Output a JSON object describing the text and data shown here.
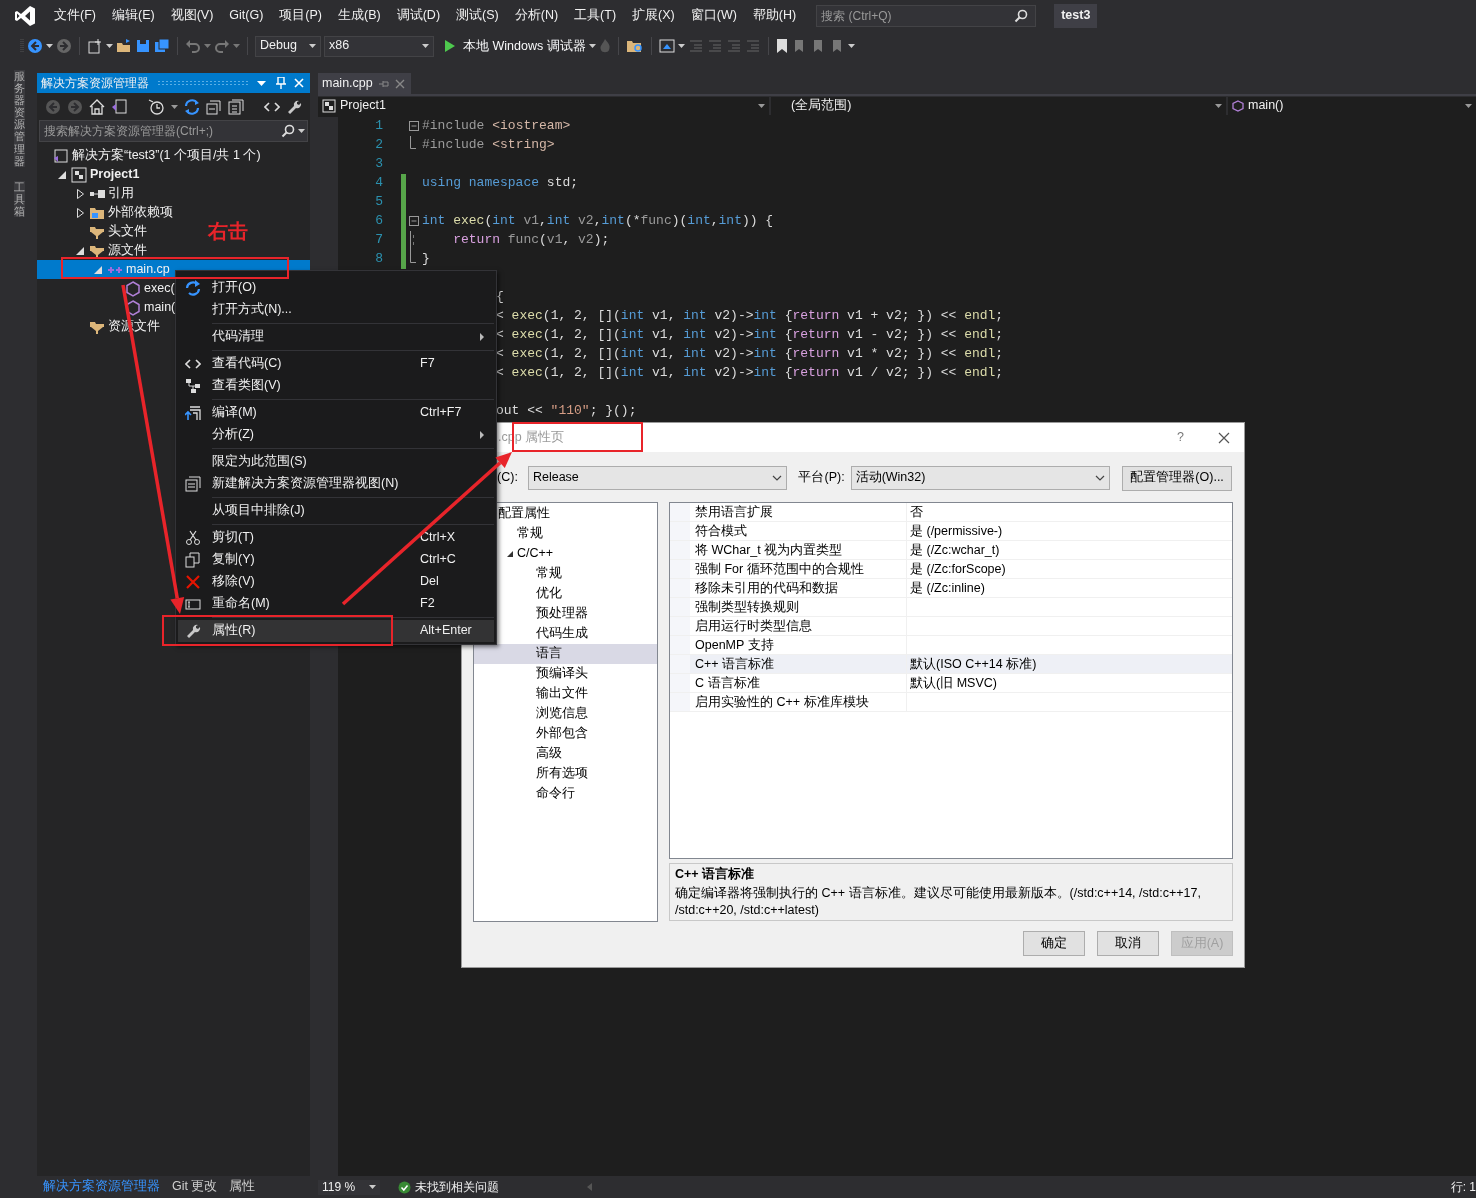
{
  "menu_bar": {
    "items": [
      "文件(F)",
      "编辑(E)",
      "视图(V)",
      "Git(G)",
      "项目(P)",
      "生成(B)",
      "调试(D)",
      "测试(S)",
      "分析(N)",
      "工具(T)",
      "扩展(X)",
      "窗口(W)",
      "帮助(H)"
    ]
  },
  "search": {
    "placeholder": "搜索 (Ctrl+Q)"
  },
  "solution_name": "test3",
  "toolbar": {
    "configuration": "Debug",
    "platform": "x86",
    "run_button": "本地 Windows 调试器"
  },
  "side_tabs": [
    "服务器资源管理器",
    "工具箱"
  ],
  "solution_explorer": {
    "title": "解决方案资源管理器",
    "search": {
      "placeholder": "搜索解决方案资源管理器(Ctrl+;)"
    },
    "tree": [
      {
        "label": "解决方案“test3”(1 个项目/共 1 个)",
        "kind": "solution",
        "selected": false,
        "children": [
          {
            "label": "Project1",
            "kind": "project",
            "expanded": true,
            "selected": false,
            "children": [
              {
                "label": "引用",
                "kind": "references",
                "expanded": false,
                "selected": false
              },
              {
                "label": "外部依赖项",
                "kind": "dependencies",
                "expanded": false,
                "selected": false
              },
              {
                "label": "头文件",
                "kind": "folder",
                "selected": false
              },
              {
                "label": "源文件",
                "kind": "folder",
                "expanded": true,
                "selected": false,
                "children": [
                  {
                    "label": "main.cp",
                    "kind": "cpp",
                    "expanded": true,
                    "selected": true,
                    "children": [
                      {
                        "label": "exec(",
                        "kind": "function",
                        "selected": false
                      },
                      {
                        "label": "main(",
                        "kind": "function",
                        "selected": false
                      }
                    ]
                  }
                ]
              },
              {
                "label": "资源文件",
                "kind": "folder",
                "selected": false
              }
            ]
          }
        ]
      }
    ]
  },
  "bottom_tabs": [
    {
      "label": "解决方案资源管理器",
      "selected": true
    },
    {
      "label": "Git 更改",
      "selected": false
    },
    {
      "label": "属性",
      "selected": false
    }
  ],
  "editor": {
    "tabs": [
      {
        "label": "main.cpp",
        "selected": true
      }
    ],
    "nav": {
      "project": "Project1",
      "scope": "(全局范围)",
      "member": "main()"
    },
    "lines": [
      {
        "number": "1",
        "kind": "opener",
        "modified": false,
        "tokens": [
          {
            "kind": "pre",
            "text": "#include"
          },
          {
            "kind": "inc",
            "text": " <iostream>"
          }
        ]
      },
      {
        "number": "2",
        "kind": "closer",
        "modified": false,
        "tokens": [
          {
            "kind": "pre",
            "text": "#include"
          },
          {
            "kind": "inc",
            "text": " <string>"
          }
        ]
      },
      {
        "number": "3",
        "kind": "plain",
        "modified": false
      },
      {
        "number": "4",
        "kind": "plain",
        "modified": true,
        "tokens": [
          {
            "kind": "kw",
            "text": "using"
          },
          {
            "kind": "kw",
            "text": " namespace"
          },
          {
            "kind": "plain",
            "text": " std;"
          }
        ]
      },
      {
        "number": "5",
        "kind": "plain",
        "modified": true
      },
      {
        "number": "6",
        "kind": "opener",
        "modified": true,
        "tokens": [
          {
            "kind": "kw",
            "text": "int"
          },
          {
            "kind": "fn",
            "text": " exec"
          },
          {
            "kind": "plain",
            "text": "("
          },
          {
            "kind": "kw",
            "text": "int"
          },
          {
            "kind": "param",
            "text": " v1"
          },
          {
            "kind": "plain",
            "text": ","
          },
          {
            "kind": "kw",
            "text": "int"
          },
          {
            "kind": "param",
            "text": " v2"
          },
          {
            "kind": "plain",
            "text": ","
          },
          {
            "kind": "kw",
            "text": "int"
          },
          {
            "kind": "plain",
            "text": "(*"
          },
          {
            "kind": "param",
            "text": "func"
          },
          {
            "kind": "plain",
            "text": ")("
          },
          {
            "kind": "kw",
            "text": "int"
          },
          {
            "kind": "plain",
            "text": ","
          },
          {
            "kind": "kw",
            "text": "int"
          },
          {
            "kind": "plain",
            "text": ")) {"
          }
        ]
      },
      {
        "number": "7",
        "kind": "inner",
        "modified": true,
        "tokens": [
          {
            "kind": "ctl",
            "text": "    return"
          },
          {
            "kind": "param",
            "text": " func"
          },
          {
            "kind": "plain",
            "text": "("
          },
          {
            "kind": "param",
            "text": "v1"
          },
          {
            "kind": "plain",
            "text": ", "
          },
          {
            "kind": "param",
            "text": "v2"
          },
          {
            "kind": "plain",
            "text": ");"
          }
        ]
      },
      {
        "number": "8",
        "kind": "closer",
        "modified": true,
        "tokens": [
          {
            "kind": "plain",
            "text": "}"
          }
        ]
      },
      {
        "kind": "partial"
      },
      {
        "kind": "partial",
        "tokens": [
          {
            "kind": "plain",
            "text": "{"
          }
        ]
      },
      {
        "kind": "partial",
        "tokens": [
          {
            "kind": "plain",
            "text": "<"
          },
          {
            "kind": "fn",
            "text": " exec"
          },
          {
            "kind": "plain",
            "text": "(1, 2, []("
          },
          {
            "kind": "kw",
            "text": "int"
          },
          {
            "kind": "plain",
            "text": " v1, "
          },
          {
            "kind": "kw",
            "text": "int"
          },
          {
            "kind": "plain",
            "text": " v2)->"
          },
          {
            "kind": "kw",
            "text": "int"
          },
          {
            "kind": "plain",
            "text": " {"
          },
          {
            "kind": "ctl",
            "text": "return"
          },
          {
            "kind": "plain",
            "text": " v1 + v2; }) << "
          },
          {
            "kind": "fn",
            "text": "endl"
          },
          {
            "kind": "plain",
            "text": ";"
          }
        ]
      },
      {
        "kind": "partial",
        "tokens": [
          {
            "kind": "plain",
            "text": "<"
          },
          {
            "kind": "fn",
            "text": " exec"
          },
          {
            "kind": "plain",
            "text": "(1, 2, []("
          },
          {
            "kind": "kw",
            "text": "int"
          },
          {
            "kind": "plain",
            "text": " v1, "
          },
          {
            "kind": "kw",
            "text": "int"
          },
          {
            "kind": "plain",
            "text": " v2)->"
          },
          {
            "kind": "kw",
            "text": "int"
          },
          {
            "kind": "plain",
            "text": " {"
          },
          {
            "kind": "ctl",
            "text": "return"
          },
          {
            "kind": "plain",
            "text": " v1 - v2; }) << "
          },
          {
            "kind": "fn",
            "text": "endl"
          },
          {
            "kind": "plain",
            "text": ";"
          }
        ]
      },
      {
        "kind": "partial",
        "tokens": [
          {
            "kind": "plain",
            "text": "<"
          },
          {
            "kind": "fn",
            "text": " exec"
          },
          {
            "kind": "plain",
            "text": "(1, 2, []("
          },
          {
            "kind": "kw",
            "text": "int"
          },
          {
            "kind": "plain",
            "text": " v1, "
          },
          {
            "kind": "kw",
            "text": "int"
          },
          {
            "kind": "plain",
            "text": " v2)->"
          },
          {
            "kind": "kw",
            "text": "int"
          },
          {
            "kind": "plain",
            "text": " {"
          },
          {
            "kind": "ctl",
            "text": "return"
          },
          {
            "kind": "plain",
            "text": " v1 * v2; }) << "
          },
          {
            "kind": "fn",
            "text": "endl"
          },
          {
            "kind": "plain",
            "text": ";"
          }
        ]
      },
      {
        "kind": "partial",
        "tokens": [
          {
            "kind": "plain",
            "text": "<"
          },
          {
            "kind": "fn",
            "text": " exec"
          },
          {
            "kind": "plain",
            "text": "(1, 2, []("
          },
          {
            "kind": "kw",
            "text": "int"
          },
          {
            "kind": "plain",
            "text": " v1, "
          },
          {
            "kind": "kw",
            "text": "int"
          },
          {
            "kind": "plain",
            "text": " v2)->"
          },
          {
            "kind": "kw",
            "text": "int"
          },
          {
            "kind": "plain",
            "text": " {"
          },
          {
            "kind": "ctl",
            "text": "return"
          },
          {
            "kind": "plain",
            "text": " v1 / v2; }) << "
          },
          {
            "kind": "fn",
            "text": "endl"
          },
          {
            "kind": "plain",
            "text": ";"
          }
        ]
      },
      {
        "kind": "partial"
      },
      {
        "kind": "partial",
        "tokens": [
          {
            "kind": "plain",
            "text": "out << "
          },
          {
            "kind": "str",
            "text": "\"110\""
          },
          {
            "kind": "plain",
            "text": "; }();"
          }
        ]
      }
    ]
  },
  "status_bar": {
    "zoom": "119 %",
    "issues": "未找到相关问题",
    "position": "行: 1"
  },
  "context_menu": {
    "items": [
      {
        "kind": "item",
        "label": "打开(O)",
        "selected": false,
        "submenu": false
      },
      {
        "kind": "item",
        "label": "打开方式(N)...",
        "selected": false,
        "submenu": false
      },
      {
        "kind": "separator"
      },
      {
        "kind": "item",
        "label": "代码清理",
        "selected": false,
        "submenu": true
      },
      {
        "kind": "separator"
      },
      {
        "kind": "item",
        "label": "查看代码(C)",
        "shortcut": "F7",
        "selected": false,
        "submenu": false
      },
      {
        "kind": "item",
        "label": "查看类图(V)",
        "selected": false,
        "submenu": false
      },
      {
        "kind": "separator"
      },
      {
        "kind": "item",
        "label": "编译(M)",
        "shortcut": "Ctrl+F7",
        "selected": false,
        "submenu": false
      },
      {
        "kind": "item",
        "label": "分析(Z)",
        "selected": false,
        "submenu": true
      },
      {
        "kind": "separator"
      },
      {
        "kind": "item",
        "label": "限定为此范围(S)",
        "selected": false,
        "submenu": false
      },
      {
        "kind": "item",
        "label": "新建解决方案资源管理器视图(N)",
        "selected": false,
        "submenu": false
      },
      {
        "kind": "separator"
      },
      {
        "kind": "item",
        "label": "从项目中排除(J)",
        "selected": false,
        "submenu": false
      },
      {
        "kind": "separator"
      },
      {
        "kind": "item",
        "label": "剪切(T)",
        "shortcut": "Ctrl+X",
        "selected": false,
        "submenu": false
      },
      {
        "kind": "item",
        "label": "复制(Y)",
        "shortcut": "Ctrl+C",
        "selected": false,
        "submenu": false
      },
      {
        "kind": "item",
        "label": "移除(V)",
        "shortcut": "Del",
        "selected": false,
        "submenu": false
      },
      {
        "kind": "item",
        "label": "重命名(M)",
        "shortcut": "F2",
        "selected": false,
        "submenu": false
      },
      {
        "kind": "separator"
      },
      {
        "kind": "item",
        "label": "属性(R)",
        "shortcut": "Alt+Enter",
        "selected": true,
        "submenu": false
      }
    ]
  },
  "dialog": {
    "title": ".cpp 属性页",
    "active": false,
    "help_button": "?",
    "configuration_label": "(C):",
    "configuration": "Release",
    "platform_label": "平台(P):",
    "platform": "活动(Win32)",
    "manager_button": "配置管理器(O)...",
    "tree": [
      {
        "label": "配置属性",
        "selected": false,
        "children": [
          {
            "label": "常规",
            "selected": false
          },
          {
            "label": "C/C++",
            "expanded": true,
            "selected": false,
            "children": [
              {
                "label": "常规",
                "selected": false
              },
              {
                "label": "优化",
                "selected": false
              },
              {
                "label": "预处理器",
                "selected": false
              },
              {
                "label": "代码生成",
                "selected": false
              },
              {
                "label": "语言",
                "selected": true
              },
              {
                "label": "预编译头",
                "selected": false
              },
              {
                "label": "输出文件",
                "selected": false
              },
              {
                "label": "浏览信息",
                "selected": false
              },
              {
                "label": "外部包含",
                "selected": false
              },
              {
                "label": "高级",
                "selected": false
              },
              {
                "label": "所有选项",
                "selected": false
              },
              {
                "label": "命令行",
                "selected": false
              }
            ]
          }
        ]
      }
    ],
    "properties": [
      {
        "name": "禁用语言扩展",
        "value": "否",
        "selected": false
      },
      {
        "name": "符合模式",
        "value": "是 (/permissive-)",
        "selected": false
      },
      {
        "name": "将 WChar_t 视为内置类型",
        "value": "是 (/Zc:wchar_t)",
        "selected": false
      },
      {
        "name": "强制 For 循环范围中的合规性",
        "value": "是 (/Zc:forScope)",
        "selected": false
      },
      {
        "name": "移除未引用的代码和数据",
        "value": "是 (/Zc:inline)",
        "selected": false
      },
      {
        "name": "强制类型转换规则",
        "selected": false
      },
      {
        "name": "启用运行时类型信息",
        "selected": false
      },
      {
        "name": "OpenMP 支持",
        "selected": false
      },
      {
        "name": "C++ 语言标准",
        "value": "默认(ISO C++14 标准)",
        "selected": true
      },
      {
        "name": "C 语言标准",
        "value": "默认(旧 MSVC)",
        "selected": false
      },
      {
        "name": "启用实验性的 C++ 标准库模块",
        "selected": false
      }
    ],
    "description": {
      "title": "C++ 语言标准",
      "text": "确定编译器将强制执行的 C++ 语言标准。建议尽可能使用最新版本。(/std:c++14, /std:c++17, /std:c++20, /std:c++latest)"
    },
    "buttons": [
      {
        "label": "确定",
        "disabled": false
      },
      {
        "label": "取消",
        "disabled": false
      },
      {
        "label": "应用(A)",
        "disabled": true
      }
    ]
  },
  "annotations": {
    "note": "右击"
  }
}
